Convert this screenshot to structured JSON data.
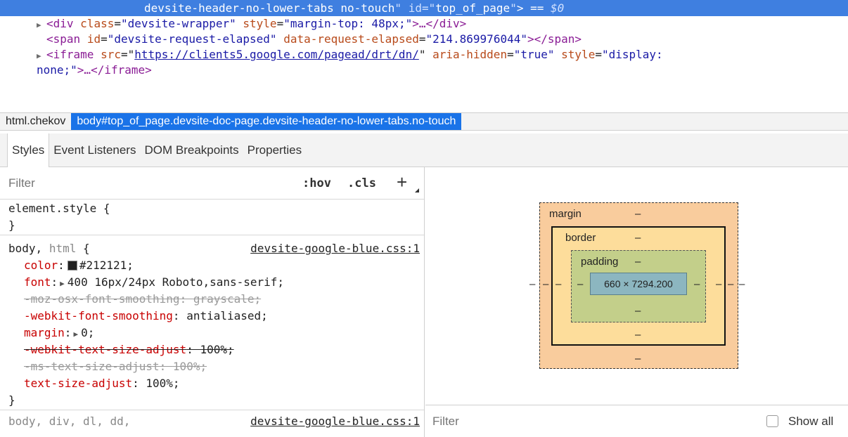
{
  "dom": {
    "selected": {
      "classes": "devsite-header-no-lower-tabs no-touch",
      "id_attr": "id",
      "id_value": "top_of_page",
      "close": "> == ",
      "dollar": "$0"
    },
    "line1": {
      "tag_open": "<div",
      "attr": "class",
      "val": "\"devsite-wrapper\"",
      "attr2": "style",
      "val2": "\"margin-top: 48px;\"",
      "rest": ">…</div>"
    },
    "line2": {
      "tag_open": "<span",
      "attr": "id",
      "val": "\"devsite-request-elapsed\"",
      "attr2": "data-request-elapsed",
      "val2": "\"214.869976044\"",
      "rest": "></span>"
    },
    "line3": {
      "tag_open": "<iframe",
      "attr": "src",
      "link": "https://clients5.google.com/pagead/drt/dn/",
      "attr2": "aria-hidden",
      "val2": "\"true\"",
      "attr3": "style",
      "val3": "\"display:"
    },
    "line4": {
      "val": "none;\"",
      "rest": ">…</iframe>"
    }
  },
  "breadcrumb": [
    {
      "label": "html.chekov"
    },
    {
      "label": "body#top_of_page.devsite-doc-page.devsite-header-no-lower-tabs.no-touch"
    }
  ],
  "tabs": [
    {
      "label": "Styles"
    },
    {
      "label": "Event Listeners"
    },
    {
      "label": "DOM Breakpoints"
    },
    {
      "label": "Properties"
    }
  ],
  "styles": {
    "filter_placeholder": "Filter",
    "hov": ":hov",
    "cls": ".cls",
    "plus": "+",
    "element_style": "element.style {",
    "close_brace": "}",
    "rule1": {
      "selector_main": "body,",
      "selector_dim": "html",
      "open": "{",
      "source": "devsite-google-blue.css:1",
      "decls": [
        {
          "prop": "color",
          "value": "#212121;"
        },
        {
          "prop": "font",
          "value": "400 16px/24px Roboto,sans-serif;"
        },
        {
          "prop": "-moz-osx-font-smoothing",
          "value": "grayscale;"
        },
        {
          "prop": "-webkit-font-smoothing",
          "value": "antialiased;"
        },
        {
          "prop": "margin",
          "value": "0;"
        },
        {
          "prop": "-webkit-text-size-adjust",
          "value": "100%;"
        },
        {
          "prop": "-ms-text-size-adjust",
          "value": "100%;"
        },
        {
          "prop": "text-size-adjust",
          "value": "100%;"
        }
      ]
    },
    "rule2": {
      "selector": "body, div, dl, dd,",
      "source": "devsite-google-blue.css:1"
    }
  },
  "box_model": {
    "margin_label": "margin",
    "border_label": "border",
    "padding_label": "padding",
    "content": "660 × 7294.200",
    "dash": "–",
    "swatch_color": "#212121"
  },
  "computed": {
    "filter_placeholder": "Filter",
    "show_all": "Show all"
  }
}
